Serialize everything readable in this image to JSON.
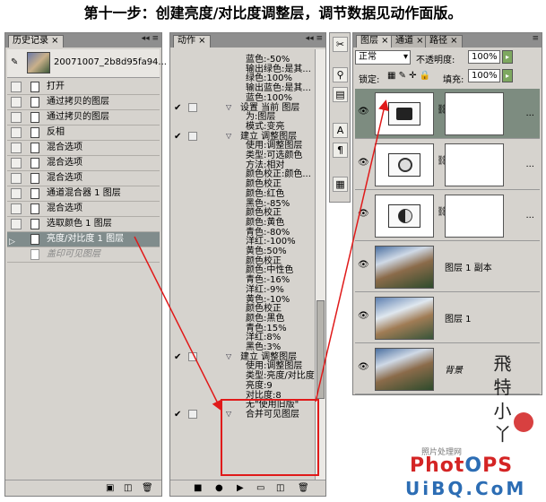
{
  "heading": "第十一步：创建亮度/对比度调整层，调节数据见动作面版。",
  "history": {
    "tab": "历史记录",
    "snapshot_name": "20071007_2b8d95fa94...",
    "items": [
      {
        "label": "打开"
      },
      {
        "label": "通过拷贝的图层"
      },
      {
        "label": "通过拷贝的图层"
      },
      {
        "label": "反相"
      },
      {
        "label": "混合选项"
      },
      {
        "label": "混合选项"
      },
      {
        "label": "混合选项"
      },
      {
        "label": "通道混合器 1 图层"
      },
      {
        "label": "混合选项"
      },
      {
        "label": "选取颜色 1 图层"
      },
      {
        "label": "亮度/对比度 1 图层"
      },
      {
        "label": "盖印可见图层"
      }
    ]
  },
  "actions": {
    "tab": "动作",
    "lines": [
      "蓝色:-50%",
      "输出绿色:是其...",
      "绿色:100%",
      "输出蓝色:是其...",
      "蓝色:100%",
      "设置 当前 图层",
      "为:图层",
      "模式:变亮",
      "建立 调整图层",
      "使用:调整图层",
      "类型:可选颜色",
      "方法:相对",
      "颜色校正:颜色...",
      "颜色校正",
      "颜色:红色",
      "黑色:-85%",
      "颜色校正",
      "颜色:黄色",
      "青色:-80%",
      "洋红:-100%",
      "黄色:50%",
      "颜色校正",
      "颜色:中性色",
      "青色:-16%",
      "洋红:-9%",
      "黄色:-10%",
      "颜色校正",
      "颜色:黑色",
      "青色:15%",
      "洋红:8%",
      "黑色:3%",
      "建立 调整图层",
      "使用:调整图层",
      "类型:亮度/对比度",
      "亮度:9",
      "对比度:8",
      "无\"使用旧版\"",
      "合并可见图层"
    ]
  },
  "layers": {
    "tabs": [
      "图层",
      "通道",
      "路径"
    ],
    "blend_mode": "正常",
    "opacity_label": "不透明度:",
    "opacity_value": "100%",
    "lock_label": "锁定:",
    "fill_label": "填充:",
    "fill_value": "100%",
    "items": [
      {
        "name": ""
      },
      {
        "name": ""
      },
      {
        "name": ""
      },
      {
        "name": "图层 1 副本"
      },
      {
        "name": "图层 1"
      },
      {
        "name": "背景"
      }
    ]
  },
  "watermark": {
    "small": "照片处理网",
    "brand_a": "Phot",
    "brand_o": "O",
    "brand_b": "PS",
    "url": "UiBQ.CoM"
  },
  "accent_colors": {
    "highlight": "#e01a1a",
    "selected_row": "#808c8c",
    "brand_red": "#d42424",
    "brand_blue": "#2c6db4"
  }
}
